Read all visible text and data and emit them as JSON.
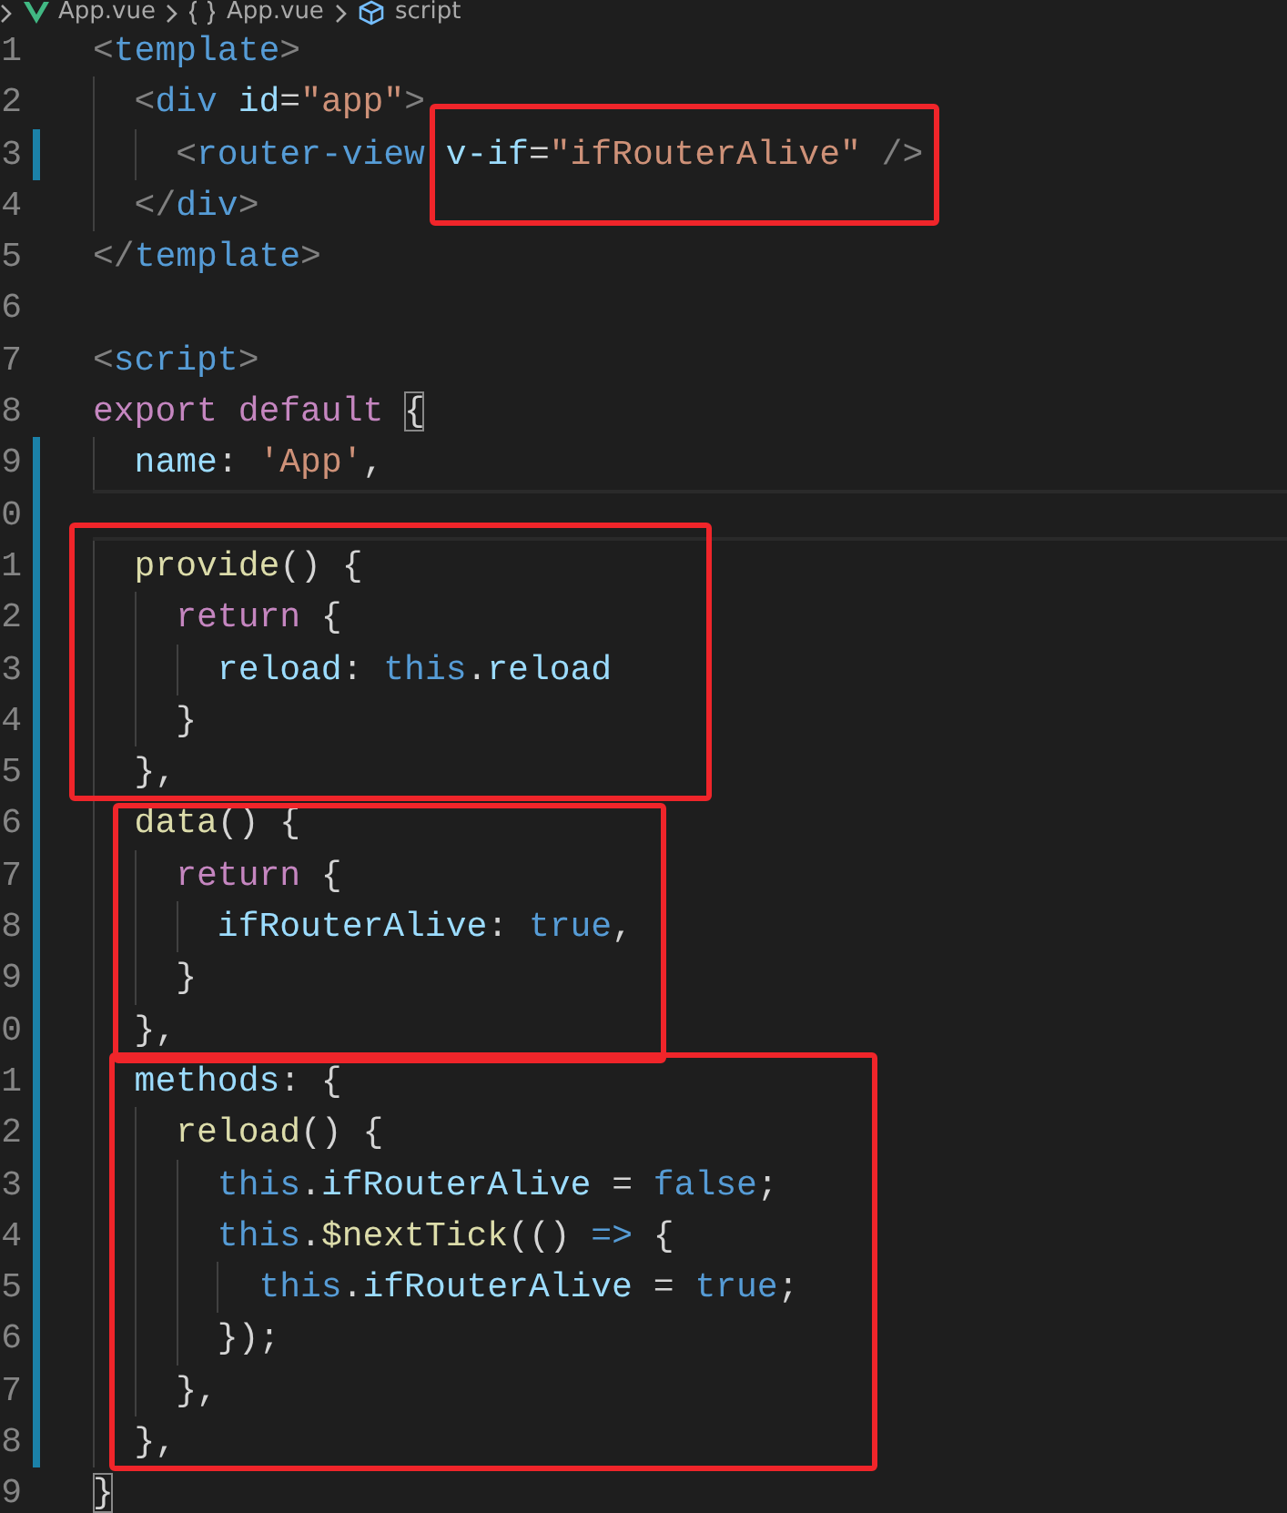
{
  "breadcrumbs": [
    {
      "kind": "file",
      "label": "App.vue"
    },
    {
      "kind": "module",
      "label": "App.vue"
    },
    {
      "kind": "element",
      "label": "script"
    }
  ],
  "lines": [
    {
      "number": "1",
      "modified": false,
      "current": false,
      "tokens": [
        {
          "kind": "punct",
          "text": "<"
        },
        {
          "kind": "tag",
          "text": "template"
        },
        {
          "kind": "punct",
          "text": ">"
        }
      ]
    },
    {
      "number": "2",
      "modified": false,
      "current": false,
      "tokens": [
        {
          "kind": "punct",
          "text": "  <"
        },
        {
          "kind": "tag",
          "text": "div"
        },
        {
          "kind": "attr",
          "text": " id"
        },
        {
          "kind": "plain",
          "text": "="
        },
        {
          "kind": "string",
          "text": "\"app\""
        },
        {
          "kind": "punct",
          "text": ">"
        }
      ]
    },
    {
      "number": "3",
      "modified": true,
      "current": false,
      "tokens": [
        {
          "kind": "punct",
          "text": "    <"
        },
        {
          "kind": "tag",
          "text": "router-view"
        },
        {
          "kind": "attr",
          "text": " v-if"
        },
        {
          "kind": "plain",
          "text": "="
        },
        {
          "kind": "string",
          "text": "\"ifRouterAlive\""
        },
        {
          "kind": "punct",
          "text": " />"
        }
      ]
    },
    {
      "number": "4",
      "modified": false,
      "current": false,
      "tokens": [
        {
          "kind": "punct",
          "text": "  </"
        },
        {
          "kind": "tag",
          "text": "div"
        },
        {
          "kind": "punct",
          "text": ">"
        }
      ]
    },
    {
      "number": "5",
      "modified": false,
      "current": false,
      "tokens": [
        {
          "kind": "punct",
          "text": "</"
        },
        {
          "kind": "tag",
          "text": "template"
        },
        {
          "kind": "punct",
          "text": ">"
        }
      ]
    },
    {
      "number": "6",
      "modified": false,
      "current": false
    },
    {
      "number": "7",
      "modified": false,
      "current": false,
      "tokens": [
        {
          "kind": "punct",
          "text": "<"
        },
        {
          "kind": "tag",
          "text": "script"
        },
        {
          "kind": "punct",
          "text": ">"
        }
      ]
    },
    {
      "number": "8",
      "modified": false,
      "current": false,
      "tokens": [
        {
          "kind": "keyword",
          "text": "export default "
        },
        {
          "kind": "bracket_match",
          "text": "{"
        }
      ]
    },
    {
      "number": "9",
      "modified": true,
      "current": false,
      "tokens": [
        {
          "kind": "prop",
          "text": "  name"
        },
        {
          "kind": "plain",
          "text": ": "
        },
        {
          "kind": "string",
          "text": "'App'"
        },
        {
          "kind": "plain",
          "text": ","
        }
      ]
    },
    {
      "number": "0",
      "modified": true,
      "current": true
    },
    {
      "number": "1",
      "modified": true,
      "current": false,
      "tokens": [
        {
          "kind": "func",
          "text": "  provide"
        },
        {
          "kind": "plain",
          "text": "() {"
        }
      ]
    },
    {
      "number": "2",
      "modified": true,
      "current": false,
      "tokens": [
        {
          "kind": "keyword",
          "text": "    return"
        },
        {
          "kind": "plain",
          "text": " {"
        }
      ]
    },
    {
      "number": "3",
      "modified": true,
      "current": false,
      "tokens": [
        {
          "kind": "prop",
          "text": "      reload"
        },
        {
          "kind": "plain",
          "text": ": "
        },
        {
          "kind": "const",
          "text": "this"
        },
        {
          "kind": "plain",
          "text": "."
        },
        {
          "kind": "prop",
          "text": "reload"
        }
      ]
    },
    {
      "number": "4",
      "modified": true,
      "current": false,
      "tokens": [
        {
          "kind": "plain",
          "text": "    }"
        }
      ]
    },
    {
      "number": "5",
      "modified": true,
      "current": false,
      "tokens": [
        {
          "kind": "plain",
          "text": "  },"
        }
      ]
    },
    {
      "number": "6",
      "modified": true,
      "current": false,
      "tokens": [
        {
          "kind": "func",
          "text": "  data"
        },
        {
          "kind": "plain",
          "text": "() {"
        }
      ]
    },
    {
      "number": "7",
      "modified": true,
      "current": false,
      "tokens": [
        {
          "kind": "keyword",
          "text": "    return"
        },
        {
          "kind": "plain",
          "text": " {"
        }
      ]
    },
    {
      "number": "8",
      "modified": true,
      "current": false,
      "tokens": [
        {
          "kind": "prop",
          "text": "      ifRouterAlive"
        },
        {
          "kind": "plain",
          "text": ": "
        },
        {
          "kind": "const",
          "text": "true"
        },
        {
          "kind": "plain",
          "text": ","
        }
      ]
    },
    {
      "number": "9",
      "modified": true,
      "current": false,
      "tokens": [
        {
          "kind": "plain",
          "text": "    }"
        }
      ]
    },
    {
      "number": "0",
      "modified": true,
      "current": false,
      "tokens": [
        {
          "kind": "plain",
          "text": "  },"
        }
      ]
    },
    {
      "number": "1",
      "modified": true,
      "current": false,
      "tokens": [
        {
          "kind": "prop",
          "text": "  methods"
        },
        {
          "kind": "plain",
          "text": ": {"
        }
      ]
    },
    {
      "number": "2",
      "modified": true,
      "current": false,
      "tokens": [
        {
          "kind": "func",
          "text": "    reload"
        },
        {
          "kind": "plain",
          "text": "() {"
        }
      ]
    },
    {
      "number": "3",
      "modified": true,
      "current": false,
      "tokens": [
        {
          "kind": "const",
          "text": "      this"
        },
        {
          "kind": "plain",
          "text": "."
        },
        {
          "kind": "prop",
          "text": "ifRouterAlive"
        },
        {
          "kind": "plain",
          "text": " = "
        },
        {
          "kind": "const",
          "text": "false"
        },
        {
          "kind": "plain",
          "text": ";"
        }
      ]
    },
    {
      "number": "4",
      "modified": true,
      "current": false,
      "tokens": [
        {
          "kind": "const",
          "text": "      this"
        },
        {
          "kind": "plain",
          "text": "."
        },
        {
          "kind": "func",
          "text": "$nextTick"
        },
        {
          "kind": "plain",
          "text": "(() "
        },
        {
          "kind": "const",
          "text": "=>"
        },
        {
          "kind": "plain",
          "text": " {"
        }
      ]
    },
    {
      "number": "5",
      "modified": true,
      "current": false,
      "tokens": [
        {
          "kind": "const",
          "text": "        this"
        },
        {
          "kind": "plain",
          "text": "."
        },
        {
          "kind": "prop",
          "text": "ifRouterAlive"
        },
        {
          "kind": "plain",
          "text": " = "
        },
        {
          "kind": "const",
          "text": "true"
        },
        {
          "kind": "plain",
          "text": ";"
        }
      ]
    },
    {
      "number": "6",
      "modified": true,
      "current": false,
      "tokens": [
        {
          "kind": "plain",
          "text": "      });"
        }
      ]
    },
    {
      "number": "7",
      "modified": true,
      "current": false,
      "tokens": [
        {
          "kind": "plain",
          "text": "    },"
        }
      ]
    },
    {
      "number": "8",
      "modified": true,
      "current": false,
      "tokens": [
        {
          "kind": "plain",
          "text": "  },"
        }
      ]
    },
    {
      "number": "9",
      "modified": false,
      "current": false,
      "tokens": [
        {
          "kind": "bracket_match",
          "text": "}"
        }
      ]
    }
  ],
  "annotations": [
    {
      "kind": "box"
    },
    {
      "kind": "box"
    },
    {
      "kind": "box"
    },
    {
      "kind": "box"
    }
  ]
}
